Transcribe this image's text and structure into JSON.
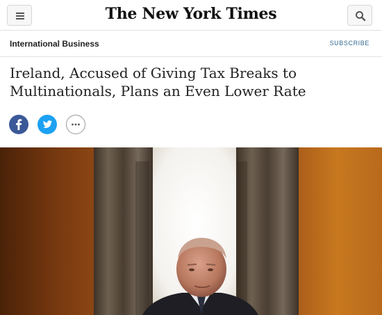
{
  "header": {
    "logo_text": "The New York Times",
    "menu_icon": "hamburger-menu-icon",
    "search_icon": "search-icon"
  },
  "section": {
    "name": "International Business",
    "subscribe_label": "SUBSCRIBE"
  },
  "article": {
    "headline": "Ireland, Accused of Giving Tax Breaks to Multinationals, Plans an Even Lower Rate"
  },
  "share": {
    "facebook_icon": "facebook-icon",
    "twitter_icon": "twitter-icon",
    "more_icon": "more-options-icon"
  },
  "colors": {
    "link_blue": "#326891",
    "facebook": "#3b5998",
    "twitter": "#1da1f2"
  }
}
